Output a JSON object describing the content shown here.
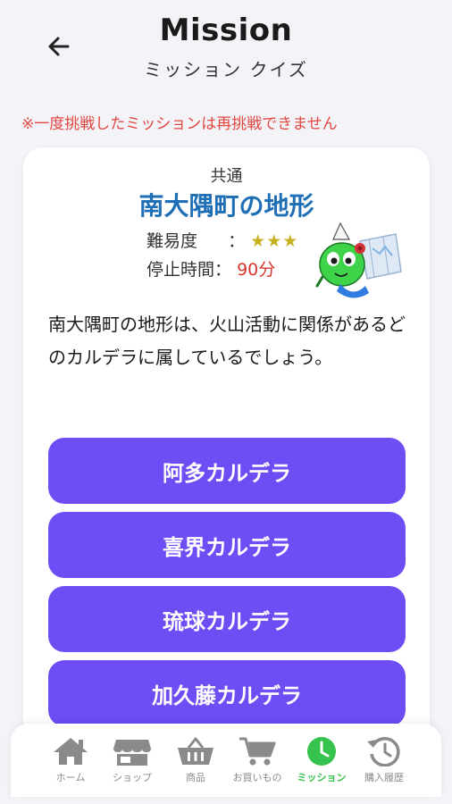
{
  "header": {
    "back_icon": "arrow-left-icon",
    "title": "Mission",
    "subtitle": "ミッション クイズ"
  },
  "notice": "※一度挑戦したミッションは再挑戦できません",
  "mission": {
    "category": "共通",
    "title": "南大隅町の地形",
    "difficulty_label": "難易度",
    "difficulty_sep": "：",
    "difficulty_stars": "★★★",
    "stop_time_label": "停止時間：",
    "stop_time_value": "90分",
    "mascot_icon": "green-mascot-with-map-icon",
    "question": "南大隅町の地形は、火山活動に関係があるどのカルデラに属しているでしょう。"
  },
  "choices": [
    "阿多カルデラ",
    "喜界カルデラ",
    "琉球カルデラ",
    "加久藤カルデラ"
  ],
  "colors": {
    "accent": "#6e4df4",
    "title_blue": "#1f6fb7",
    "notice_red": "#e0473f",
    "active_green": "#35c24d",
    "inactive_gray": "#8a8a8a"
  },
  "nav": {
    "items": [
      {
        "label": "ホーム",
        "icon": "home-icon"
      },
      {
        "label": "ショップ",
        "icon": "shop-icon"
      },
      {
        "label": "商品",
        "icon": "basket-icon"
      },
      {
        "label": "お買いもの",
        "icon": "cart-icon"
      },
      {
        "label": "ミッション",
        "icon": "clock-icon",
        "active": true
      },
      {
        "label": "購入履歴",
        "icon": "history-icon"
      }
    ]
  }
}
